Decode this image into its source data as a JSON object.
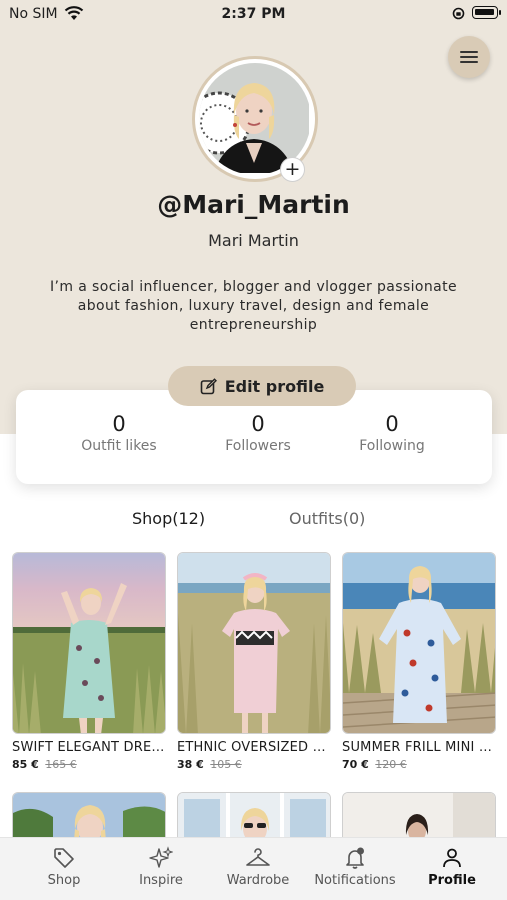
{
  "status_bar": {
    "carrier": "No SIM",
    "time": "2:37 PM"
  },
  "profile": {
    "handle": "@Mari_Martin",
    "name": "Mari Martin",
    "bio": "I’m a social influencer, blogger and vlogger passionate about fashion, luxury travel, design and female entrepreneurship",
    "edit_label": "Edit profile"
  },
  "stats": [
    {
      "value": "0",
      "label": "Outfit likes"
    },
    {
      "value": "0",
      "label": "Followers"
    },
    {
      "value": "0",
      "label": "Following"
    }
  ],
  "tabs": {
    "shop": "Shop(12)",
    "outfits": "Outfits(0)"
  },
  "products": [
    {
      "name": "SWIFT ELEGANT DRESS",
      "price": "85 €",
      "old_price": "165 €"
    },
    {
      "name": "ETHNIC OVERSIZED DRESS",
      "price": "38 €",
      "old_price": "105 €"
    },
    {
      "name": "SUMMER FRILL MINI DRESS",
      "price": "70 €",
      "old_price": "120 €"
    }
  ],
  "nav": {
    "shop": "Shop",
    "inspire": "Inspire",
    "wardrobe": "Wardrobe",
    "notifications": "Notifications",
    "profile": "Profile"
  },
  "colors": {
    "hero_bg": "#ece6dc",
    "accent": "#d9cbb6"
  }
}
